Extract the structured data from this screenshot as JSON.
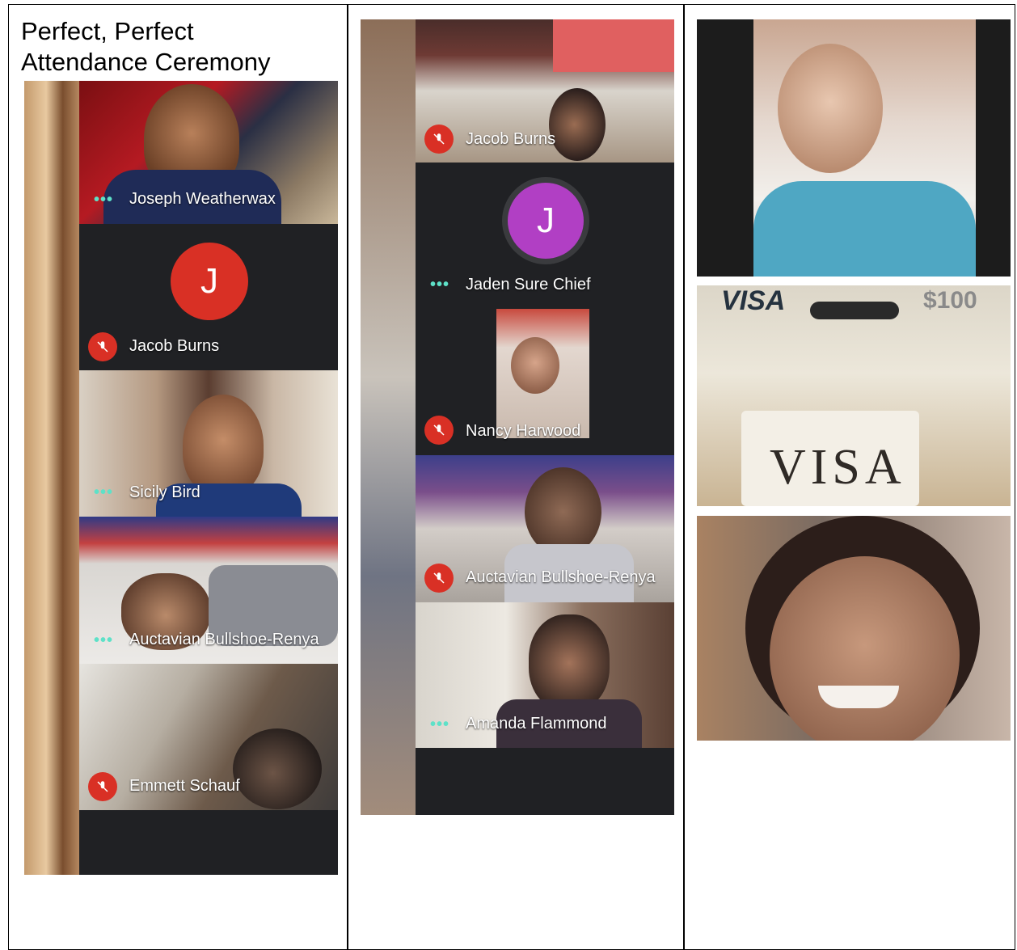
{
  "document": {
    "title_line1": "Perfect, Perfect",
    "title_line2": "Attendance Ceremony"
  },
  "left_screenshot": {
    "participants": [
      {
        "name": "Joseph Weatherwax",
        "status": "active"
      },
      {
        "name": "Jacob Burns",
        "status": "muted",
        "avatar_letter": "J",
        "avatar_color": "#d93025"
      },
      {
        "name": "Sicily Bird",
        "status": "active"
      },
      {
        "name": "Auctavian Bullshoe-Renya",
        "status": "active"
      },
      {
        "name": "Emmett Schauf",
        "status": "muted"
      }
    ]
  },
  "middle_screenshot": {
    "participants": [
      {
        "name": "Jacob Burns",
        "status": "muted"
      },
      {
        "name": "Jaden Sure Chief",
        "status": "active",
        "avatar_letter": "J",
        "avatar_color": "#b13fc4"
      },
      {
        "name": "Nancy Harwood",
        "status": "muted"
      },
      {
        "name": "Auctavian Bullshoe-Renya",
        "status": "muted"
      },
      {
        "name": "Amanda Flammond",
        "status": "active"
      }
    ]
  },
  "right_photos": {
    "visa_card": {
      "brand_top": "VISA",
      "amount": "$100",
      "brand_card": "VISA"
    }
  },
  "colors": {
    "meet_dark": "#202124",
    "mic_off_red": "#d93025",
    "talking_dots": "#5ee1c8"
  },
  "icons": {
    "mic_off": "mic-off-icon",
    "talking": "talking-dots-icon"
  }
}
